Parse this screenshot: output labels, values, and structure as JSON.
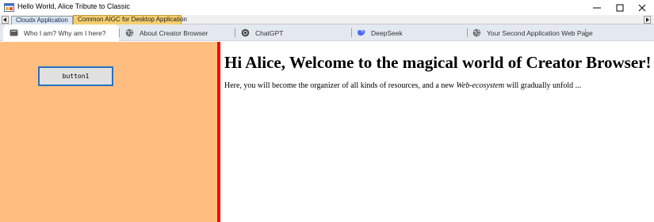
{
  "window": {
    "title": "Hello World, Alice Tribute to Classic",
    "controls": [
      "minimize",
      "maximize",
      "close"
    ]
  },
  "outer_tabs": [
    {
      "label": "Cloudx Application",
      "selected": false
    },
    {
      "label": "Common AIGC for Desktop Application",
      "selected": true
    }
  ],
  "inner_tabs": [
    {
      "label": "Who I am? Why am I here?",
      "icon": "page-icon",
      "active": true
    },
    {
      "label": "About Creator Browser",
      "icon": "globe-icon",
      "active": false
    },
    {
      "label": "ChatGPT",
      "icon": "chatgpt-icon",
      "active": false
    },
    {
      "label": "DeepSeek",
      "icon": "deepseek-icon",
      "active": false
    },
    {
      "label": "Your Second Application Web Page",
      "icon": "globe-icon",
      "active": false
    }
  ],
  "left_pane": {
    "button_label": "button1",
    "background": "#ffbe80"
  },
  "right_pane": {
    "heading": "Hi Alice, Welcome to the magical world of Creator Browser!",
    "para_before": "Here, you will become the organizer of all kinds of resources, and a new ",
    "para_italic": "Web-ecosystem",
    "para_after": " will gradually unfold ..."
  },
  "colors": {
    "splitter": "#ff0000",
    "button_border": "#2a6fc3",
    "outer_tab_selected": "#f5ce6e",
    "outer_tab_unselected": "#dbe7f5"
  }
}
